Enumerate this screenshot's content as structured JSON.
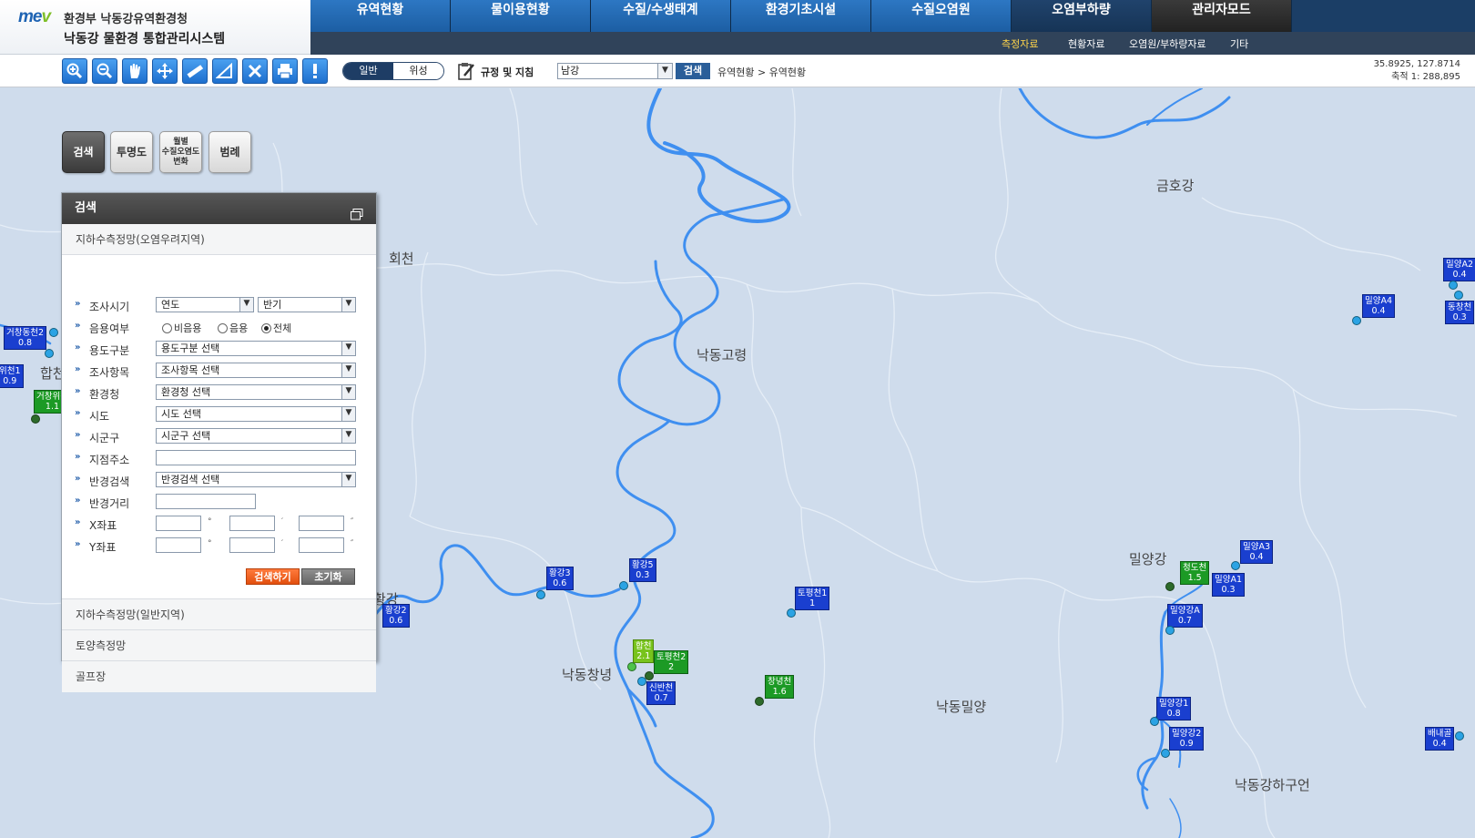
{
  "logo": {
    "mark_main": "me",
    "mark_accent": "v",
    "org": "환경부 낙동강유역환경청",
    "system": "낙동강 물환경 통합관리시스템"
  },
  "topnav": [
    "유역현황",
    "물이용현황",
    "수질/수생태계",
    "환경기초시설",
    "수질오염원",
    "오염부하량",
    "관리자모드"
  ],
  "subnav": [
    {
      "label": "측정자료",
      "active": true
    },
    {
      "label": "현황자료",
      "active": false
    },
    {
      "label": "오염원/부하량자료",
      "active": false
    },
    {
      "label": "기타",
      "active": false
    }
  ],
  "toolbar": {
    "tools": [
      "zoom-in-icon",
      "zoom-out-icon",
      "pan-hand-icon",
      "move-icon",
      "measure-distance-icon",
      "measure-area-icon",
      "clear-icon",
      "print-icon",
      "info-icon"
    ],
    "map_type": {
      "general": "일반",
      "satellite": "위성"
    },
    "rules_label": "규정 및 지침",
    "basin_select": "남강",
    "search_label": "검색",
    "breadcrumb": "유역현황 > 유역현황",
    "coords": "35.8925, 127.8714",
    "scale": "축적 1: 288,895"
  },
  "side_tabs": {
    "search": "검색",
    "transparency": "투명도",
    "monthly_line1": "월별",
    "monthly_line2": "수질오염도",
    "monthly_line3": "변화",
    "legend": "범례"
  },
  "panel": {
    "title": "검색",
    "section_active": "지하수측정망(오염우려지역)",
    "fields": {
      "survey_period": {
        "label": "조사시기",
        "year": "연도",
        "half": "반기"
      },
      "usage": {
        "label": "음용여부",
        "opt_non_drink": "비음용",
        "opt_drink": "음용",
        "opt_all": "전체"
      },
      "purpose": {
        "label": "용도구분",
        "value": "용도구분 선택"
      },
      "item": {
        "label": "조사항목",
        "value": "조사항목 선택"
      },
      "office": {
        "label": "환경청",
        "value": "환경청 선택"
      },
      "province": {
        "label": "시도",
        "value": "시도 선택"
      },
      "district": {
        "label": "시군구",
        "value": "시군구 선택"
      },
      "address": {
        "label": "지점주소"
      },
      "radius_search": {
        "label": "반경검색",
        "value": "반경검색 선택"
      },
      "radius_distance": {
        "label": "반경거리"
      },
      "x_coord": {
        "label": "X좌표",
        "deg": "°",
        "min": "′",
        "sec": "″"
      },
      "y_coord": {
        "label": "Y좌표",
        "deg": "°",
        "min": "′",
        "sec": "″"
      }
    },
    "btn_search": "검색하기",
    "btn_reset": "초기화",
    "sections_below": [
      "지하수측정망(일반지역)",
      "토양측정망",
      "골프장"
    ]
  },
  "map": {
    "places": [
      "회천",
      "낙동고령",
      "금호강",
      "합천",
      "황강",
      "낙동창녕",
      "낙동밀양",
      "밀양강",
      "낙동강하구언"
    ],
    "stations": [
      {
        "name": "거창동천2",
        "value": "0.8",
        "color": "blue"
      },
      {
        "name": "위천1",
        "value": "0.9",
        "color": "blue"
      },
      {
        "name": "거창위천",
        "value": "1.1",
        "color": "green"
      },
      {
        "name": "황강3",
        "value": "0.6",
        "color": "blue"
      },
      {
        "name": "황강5",
        "value": "0.3",
        "color": "blue"
      },
      {
        "name": "황강2",
        "value": "0.6",
        "color": "blue"
      },
      {
        "name": "토평천1",
        "value": "1",
        "color": "blue"
      },
      {
        "name": "합천",
        "value": "2.1",
        "color": "lime"
      },
      {
        "name": "토평천2",
        "value": "2",
        "color": "green"
      },
      {
        "name": "신반천",
        "value": "0.7",
        "color": "blue"
      },
      {
        "name": "창녕천",
        "value": "1.6",
        "color": "green"
      },
      {
        "name": "밀양A2",
        "value": "0.4",
        "color": "blue"
      },
      {
        "name": "밀양A4",
        "value": "0.4",
        "color": "blue"
      },
      {
        "name": "동창천",
        "value": "0.3",
        "color": "blue"
      },
      {
        "name": "밀양A3",
        "value": "0.4",
        "color": "blue"
      },
      {
        "name": "청도천",
        "value": "1.5",
        "color": "green"
      },
      {
        "name": "밀양A1",
        "value": "0.3",
        "color": "blue"
      },
      {
        "name": "밀양강A",
        "value": "0.7",
        "color": "blue"
      },
      {
        "name": "밀양강1",
        "value": "0.8",
        "color": "blue"
      },
      {
        "name": "밀양강2",
        "value": "0.9",
        "color": "blue"
      },
      {
        "name": "배내골",
        "value": "0.4",
        "color": "blue"
      }
    ]
  },
  "colors": {
    "nav_blue": "#2d77c3",
    "nav_navy": "#1b3e66",
    "river": "#3f8ff0",
    "map_bg": "#cfdcec",
    "station_blue": "#1a3fcf",
    "station_green": "#1c9a25",
    "station_lime": "#78c31c"
  }
}
